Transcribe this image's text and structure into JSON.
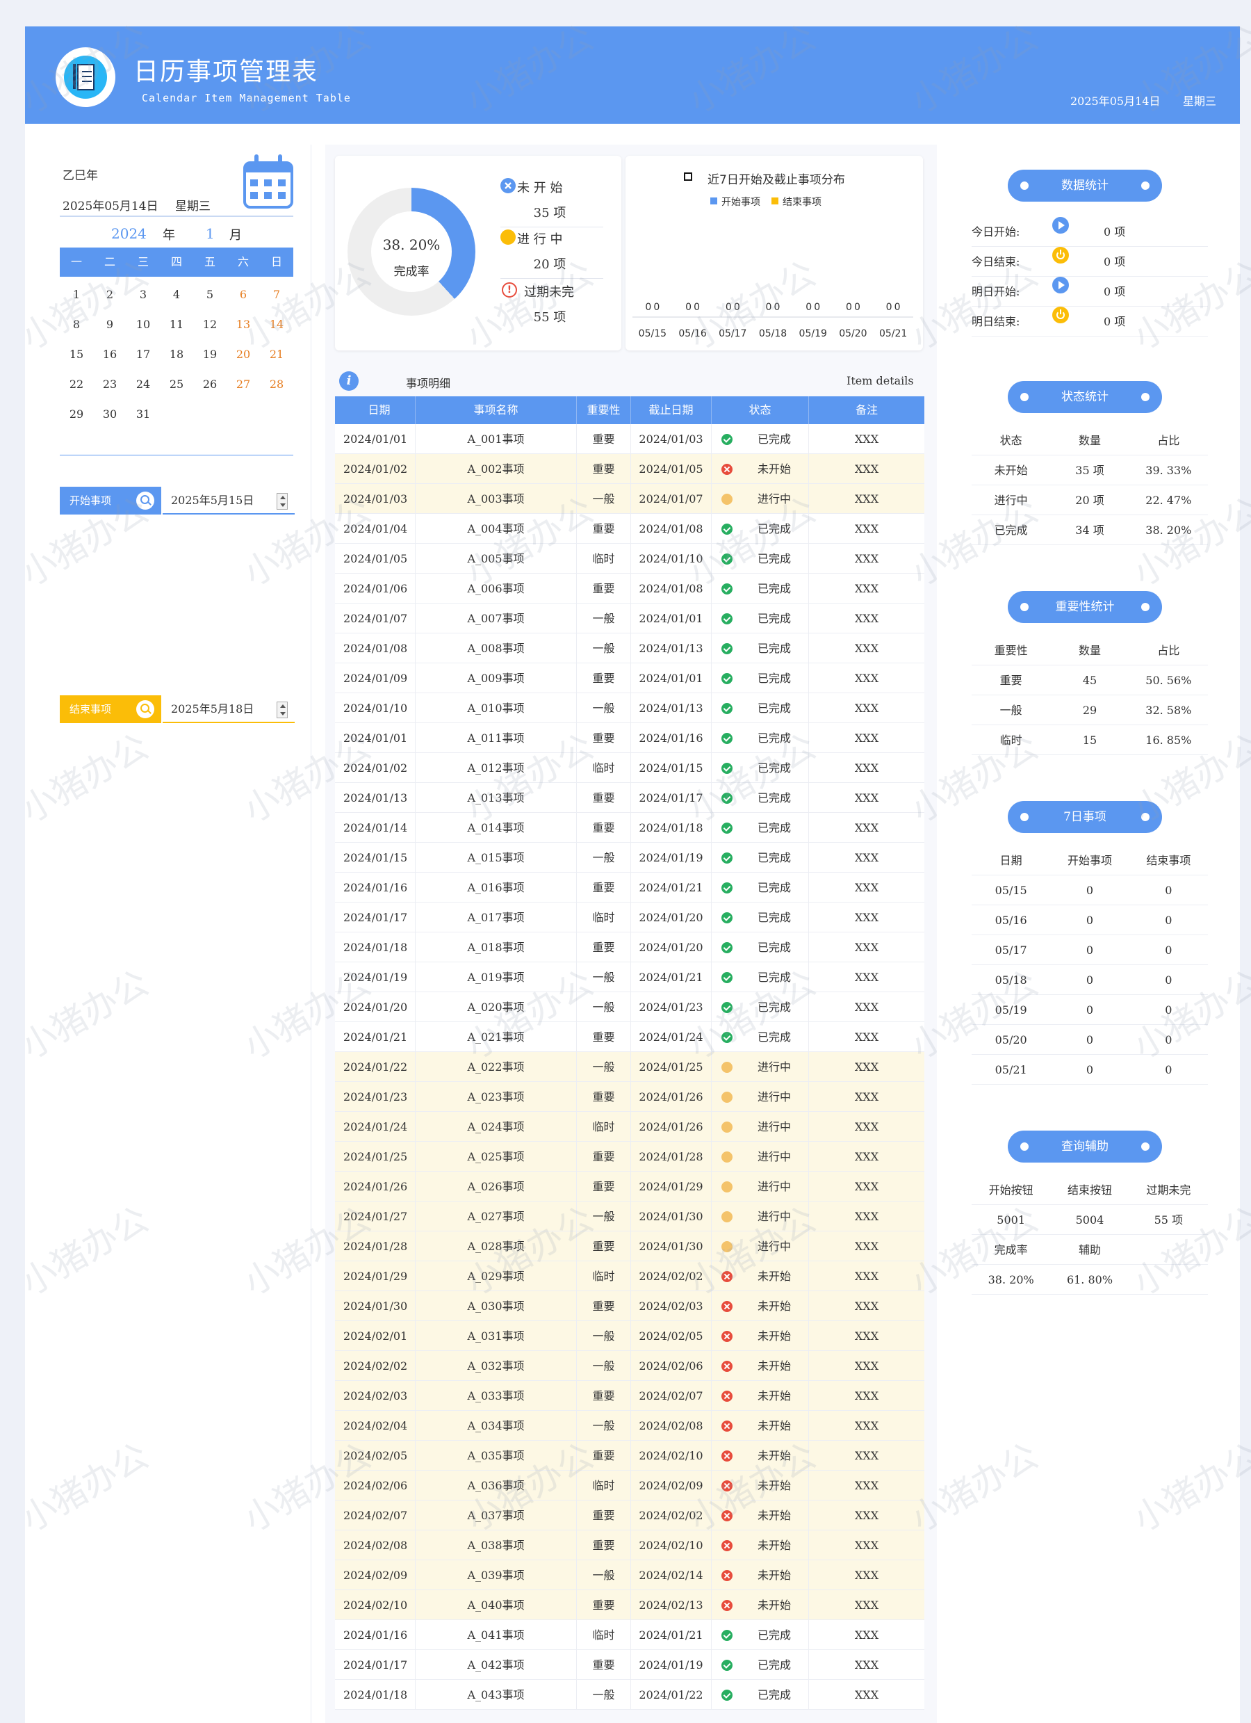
{
  "header": {
    "title": "日历事项管理表",
    "subtitle": "Calendar Item Management Table",
    "date": "2025年05月14日",
    "weekday": "星期三"
  },
  "left": {
    "lunar_year": "乙巳年",
    "today": "2025年05月14日",
    "weekday": "星期三",
    "calendar": {
      "year": "2024",
      "year_unit": "年",
      "month": "1",
      "month_unit": "月",
      "weekdays": [
        "一",
        "二",
        "三",
        "四",
        "五",
        "六",
        "日"
      ],
      "weeks": [
        [
          "1",
          "2",
          "3",
          "4",
          "5",
          "6",
          "7"
        ],
        [
          "8",
          "9",
          "10",
          "11",
          "12",
          "13",
          "14"
        ],
        [
          "15",
          "16",
          "17",
          "18",
          "19",
          "20",
          "21"
        ],
        [
          "22",
          "23",
          "24",
          "25",
          "26",
          "27",
          "28"
        ],
        [
          "29",
          "30",
          "31",
          "",
          "",
          "",
          ""
        ]
      ]
    },
    "start_tag": "开始事项",
    "start_value": "2025年5月15日",
    "end_tag": "结束事项",
    "end_value": "2025年5月18日"
  },
  "summary": {
    "completion_rate": "38. 20%",
    "completion_label": "完成率",
    "completion_fraction": 0.382,
    "not_started_label": "未 开 始",
    "not_started_count": "35 项",
    "in_progress_label": "进 行 中",
    "in_progress_count": "20 项",
    "overdue_label": "过期未完",
    "overdue_count": "55 项"
  },
  "chart_data": {
    "type": "bar",
    "title": "近7日开始及截止事项分布",
    "categories": [
      "05/15",
      "05/16",
      "05/17",
      "05/18",
      "05/19",
      "05/20",
      "05/21"
    ],
    "series": [
      {
        "name": "开始事项",
        "values": [
          0,
          0,
          0,
          0,
          0,
          0,
          0
        ],
        "color": "#5b97f0"
      },
      {
        "name": "结束事项",
        "values": [
          0,
          0,
          0,
          0,
          0,
          0,
          0
        ],
        "color": "#fbbd08"
      }
    ],
    "data_labels": [
      "0",
      "0",
      "0",
      "0",
      "0",
      "0",
      "0",
      "0",
      "0",
      "0",
      "0",
      "0",
      "0",
      "0"
    ],
    "legend": "top"
  },
  "table": {
    "caption": "事项明细",
    "caption_en": "Item details",
    "columns": [
      "日期",
      "事项名称",
      "重要性",
      "截止日期",
      "状态",
      "备注"
    ],
    "rows": [
      {
        "date": "2024/01/01",
        "name": "A_001事项",
        "imp": "重要",
        "due": "2024/01/03",
        "status": "已完成",
        "s": "done",
        "note": "XXX"
      },
      {
        "date": "2024/01/02",
        "name": "A_002事项",
        "imp": "重要",
        "due": "2024/01/05",
        "status": "未开始",
        "s": "nots",
        "note": "XXX"
      },
      {
        "date": "2024/01/03",
        "name": "A_003事项",
        "imp": "一般",
        "due": "2024/01/07",
        "status": "进行中",
        "s": "prog",
        "note": "XXX"
      },
      {
        "date": "2024/01/04",
        "name": "A_004事项",
        "imp": "重要",
        "due": "2024/01/08",
        "status": "已完成",
        "s": "done",
        "note": "XXX"
      },
      {
        "date": "2024/01/05",
        "name": "A_005事项",
        "imp": "临时",
        "due": "2024/01/10",
        "status": "已完成",
        "s": "done",
        "note": "XXX"
      },
      {
        "date": "2024/01/06",
        "name": "A_006事项",
        "imp": "重要",
        "due": "2024/01/08",
        "status": "已完成",
        "s": "done",
        "note": "XXX"
      },
      {
        "date": "2024/01/07",
        "name": "A_007事项",
        "imp": "一般",
        "due": "2024/01/01",
        "status": "已完成",
        "s": "done",
        "note": "XXX"
      },
      {
        "date": "2024/01/08",
        "name": "A_008事项",
        "imp": "一般",
        "due": "2024/01/13",
        "status": "已完成",
        "s": "done",
        "note": "XXX"
      },
      {
        "date": "2024/01/09",
        "name": "A_009事项",
        "imp": "重要",
        "due": "2024/01/01",
        "status": "已完成",
        "s": "done",
        "note": "XXX"
      },
      {
        "date": "2024/01/10",
        "name": "A_010事项",
        "imp": "一般",
        "due": "2024/01/13",
        "status": "已完成",
        "s": "done",
        "note": "XXX"
      },
      {
        "date": "2024/01/01",
        "name": "A_011事项",
        "imp": "重要",
        "due": "2024/01/16",
        "status": "已完成",
        "s": "done",
        "note": "XXX"
      },
      {
        "date": "2024/01/02",
        "name": "A_012事项",
        "imp": "临时",
        "due": "2024/01/15",
        "status": "已完成",
        "s": "done",
        "note": "XXX"
      },
      {
        "date": "2024/01/13",
        "name": "A_013事项",
        "imp": "重要",
        "due": "2024/01/17",
        "status": "已完成",
        "s": "done",
        "note": "XXX"
      },
      {
        "date": "2024/01/14",
        "name": "A_014事项",
        "imp": "重要",
        "due": "2024/01/18",
        "status": "已完成",
        "s": "done",
        "note": "XXX"
      },
      {
        "date": "2024/01/15",
        "name": "A_015事项",
        "imp": "一般",
        "due": "2024/01/19",
        "status": "已完成",
        "s": "done",
        "note": "XXX"
      },
      {
        "date": "2024/01/16",
        "name": "A_016事项",
        "imp": "重要",
        "due": "2024/01/21",
        "status": "已完成",
        "s": "done",
        "note": "XXX"
      },
      {
        "date": "2024/01/17",
        "name": "A_017事项",
        "imp": "临时",
        "due": "2024/01/20",
        "status": "已完成",
        "s": "done",
        "note": "XXX"
      },
      {
        "date": "2024/01/18",
        "name": "A_018事项",
        "imp": "重要",
        "due": "2024/01/20",
        "status": "已完成",
        "s": "done",
        "note": "XXX"
      },
      {
        "date": "2024/01/19",
        "name": "A_019事项",
        "imp": "一般",
        "due": "2024/01/21",
        "status": "已完成",
        "s": "done",
        "note": "XXX"
      },
      {
        "date": "2024/01/20",
        "name": "A_020事项",
        "imp": "一般",
        "due": "2024/01/23",
        "status": "已完成",
        "s": "done",
        "note": "XXX"
      },
      {
        "date": "2024/01/21",
        "name": "A_021事项",
        "imp": "重要",
        "due": "2024/01/24",
        "status": "已完成",
        "s": "done",
        "note": "XXX"
      },
      {
        "date": "2024/01/22",
        "name": "A_022事项",
        "imp": "一般",
        "due": "2024/01/25",
        "status": "进行中",
        "s": "prog",
        "note": "XXX"
      },
      {
        "date": "2024/01/23",
        "name": "A_023事项",
        "imp": "重要",
        "due": "2024/01/26",
        "status": "进行中",
        "s": "prog",
        "note": "XXX"
      },
      {
        "date": "2024/01/24",
        "name": "A_024事项",
        "imp": "临时",
        "due": "2024/01/26",
        "status": "进行中",
        "s": "prog",
        "note": "XXX"
      },
      {
        "date": "2024/01/25",
        "name": "A_025事项",
        "imp": "重要",
        "due": "2024/01/28",
        "status": "进行中",
        "s": "prog",
        "note": "XXX"
      },
      {
        "date": "2024/01/26",
        "name": "A_026事项",
        "imp": "重要",
        "due": "2024/01/29",
        "status": "进行中",
        "s": "prog",
        "note": "XXX"
      },
      {
        "date": "2024/01/27",
        "name": "A_027事项",
        "imp": "一般",
        "due": "2024/01/30",
        "status": "进行中",
        "s": "prog",
        "note": "XXX"
      },
      {
        "date": "2024/01/28",
        "name": "A_028事项",
        "imp": "重要",
        "due": "2024/01/30",
        "status": "进行中",
        "s": "prog",
        "note": "XXX"
      },
      {
        "date": "2024/01/29",
        "name": "A_029事项",
        "imp": "临时",
        "due": "2024/02/02",
        "status": "未开始",
        "s": "nots",
        "note": "XXX"
      },
      {
        "date": "2024/01/30",
        "name": "A_030事项",
        "imp": "重要",
        "due": "2024/02/03",
        "status": "未开始",
        "s": "nots",
        "note": "XXX"
      },
      {
        "date": "2024/02/01",
        "name": "A_031事项",
        "imp": "一般",
        "due": "2024/02/05",
        "status": "未开始",
        "s": "nots",
        "note": "XXX"
      },
      {
        "date": "2024/02/02",
        "name": "A_032事项",
        "imp": "一般",
        "due": "2024/02/06",
        "status": "未开始",
        "s": "nots",
        "note": "XXX"
      },
      {
        "date": "2024/02/03",
        "name": "A_033事项",
        "imp": "重要",
        "due": "2024/02/07",
        "status": "未开始",
        "s": "nots",
        "note": "XXX"
      },
      {
        "date": "2024/02/04",
        "name": "A_034事项",
        "imp": "一般",
        "due": "2024/02/08",
        "status": "未开始",
        "s": "nots",
        "note": "XXX"
      },
      {
        "date": "2024/02/05",
        "name": "A_035事项",
        "imp": "重要",
        "due": "2024/02/10",
        "status": "未开始",
        "s": "nots",
        "note": "XXX"
      },
      {
        "date": "2024/02/06",
        "name": "A_036事项",
        "imp": "临时",
        "due": "2024/02/09",
        "status": "未开始",
        "s": "nots",
        "note": "XXX"
      },
      {
        "date": "2024/02/07",
        "name": "A_037事项",
        "imp": "重要",
        "due": "2024/02/02",
        "status": "未开始",
        "s": "nots",
        "note": "XXX"
      },
      {
        "date": "2024/02/08",
        "name": "A_038事项",
        "imp": "重要",
        "due": "2024/02/10",
        "status": "未开始",
        "s": "nots",
        "note": "XXX"
      },
      {
        "date": "2024/02/09",
        "name": "A_039事项",
        "imp": "一般",
        "due": "2024/02/14",
        "status": "未开始",
        "s": "nots",
        "note": "XXX"
      },
      {
        "date": "2024/02/10",
        "name": "A_040事项",
        "imp": "重要",
        "due": "2024/02/13",
        "status": "未开始",
        "s": "nots",
        "note": "XXX"
      },
      {
        "date": "2024/01/16",
        "name": "A_041事项",
        "imp": "临时",
        "due": "2024/01/21",
        "status": "已完成",
        "s": "done",
        "note": "XXX"
      },
      {
        "date": "2024/01/17",
        "name": "A_042事项",
        "imp": "重要",
        "due": "2024/01/19",
        "status": "已完成",
        "s": "done",
        "note": "XXX"
      },
      {
        "date": "2024/01/18",
        "name": "A_043事项",
        "imp": "一般",
        "due": "2024/01/22",
        "status": "已完成",
        "s": "done",
        "note": "XXX"
      }
    ]
  },
  "right": {
    "data_stats": {
      "title": "数据统计",
      "rows": [
        {
          "label": "今日开始:",
          "icon": "play-icon",
          "value": "0  项"
        },
        {
          "label": "今日结束:",
          "icon": "power-icon",
          "value": "0  项"
        },
        {
          "label": "明日开始:",
          "icon": "play-icon",
          "value": "0  项"
        },
        {
          "label": "明日结束:",
          "icon": "power-icon",
          "value": "0  项"
        }
      ]
    },
    "status_stats": {
      "title": "状态统计",
      "header": [
        "状态",
        "数量",
        "占比"
      ],
      "rows": [
        [
          "未开始",
          "35  项",
          "39. 33%"
        ],
        [
          "进行中",
          "20  项",
          "22. 47%"
        ],
        [
          "已完成",
          "34  项",
          "38. 20%"
        ]
      ]
    },
    "importance_stats": {
      "title": "重要性统计",
      "header": [
        "重要性",
        "数量",
        "占比"
      ],
      "rows": [
        [
          "重要",
          "45",
          "50. 56%"
        ],
        [
          "一般",
          "29",
          "32. 58%"
        ],
        [
          "临时",
          "15",
          "16. 85%"
        ]
      ]
    },
    "seven_day": {
      "title": "7日事项",
      "header": [
        "日期",
        "开始事项",
        "结束事项"
      ],
      "rows": [
        [
          "05/15",
          "0",
          "0"
        ],
        [
          "05/16",
          "0",
          "0"
        ],
        [
          "05/17",
          "0",
          "0"
        ],
        [
          "05/18",
          "0",
          "0"
        ],
        [
          "05/19",
          "0",
          "0"
        ],
        [
          "05/20",
          "0",
          "0"
        ],
        [
          "05/21",
          "0",
          "0"
        ]
      ]
    },
    "query": {
      "title": "查询辅助",
      "rows": [
        [
          "开始按钮",
          "结束按钮",
          "过期未完"
        ],
        [
          "5001",
          "5004",
          "55 项"
        ],
        [
          "完成率",
          "辅助",
          ""
        ],
        [
          "38. 20%",
          "61. 80%",
          ""
        ]
      ]
    }
  },
  "watermark": "小猪办公",
  "colors": {
    "primary": "#5b97f0",
    "accent": "#fbbd08",
    "done": "#27ae60",
    "notstarted": "#e74c3c",
    "progress": "#f4c36a",
    "highlight": "#fdf8e4"
  }
}
